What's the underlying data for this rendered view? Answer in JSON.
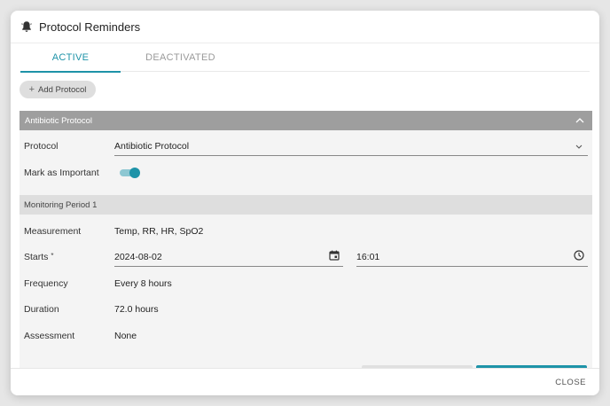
{
  "dialog": {
    "title": "Protocol Reminders",
    "icon": "bell-icon"
  },
  "tabs": [
    {
      "label": "ACTIVE",
      "active": true
    },
    {
      "label": "DEACTIVATED",
      "active": false
    }
  ],
  "add_button": {
    "icon": "plus-icon",
    "label": "Add Protocol"
  },
  "protocol_panel": {
    "header": "Antibiotic Protocol",
    "collapse_icon": "chevron-up-icon",
    "protocol_label": "Protocol",
    "protocol_value": "Antibiotic Protocol",
    "important_label": "Mark as Important",
    "important_on": true,
    "monitoring": {
      "header": "Monitoring Period 1",
      "measurement_label": "Measurement",
      "measurement_value": "Temp, RR, HR, SpO2",
      "starts_label": "Starts",
      "starts_required": "*",
      "start_date": "2024-08-02",
      "start_time": "16:01",
      "frequency_label": "Frequency",
      "frequency_value": "Every 8 hours",
      "duration_label": "Duration",
      "duration_value": "72.0 hours",
      "assessment_label": "Assessment",
      "assessment_value": "None"
    }
  },
  "footer": {
    "close_label": "CLOSE"
  },
  "colors": {
    "accent": "#1e93a8",
    "panel_header": "#9e9e9e",
    "section_header": "#dedede"
  }
}
